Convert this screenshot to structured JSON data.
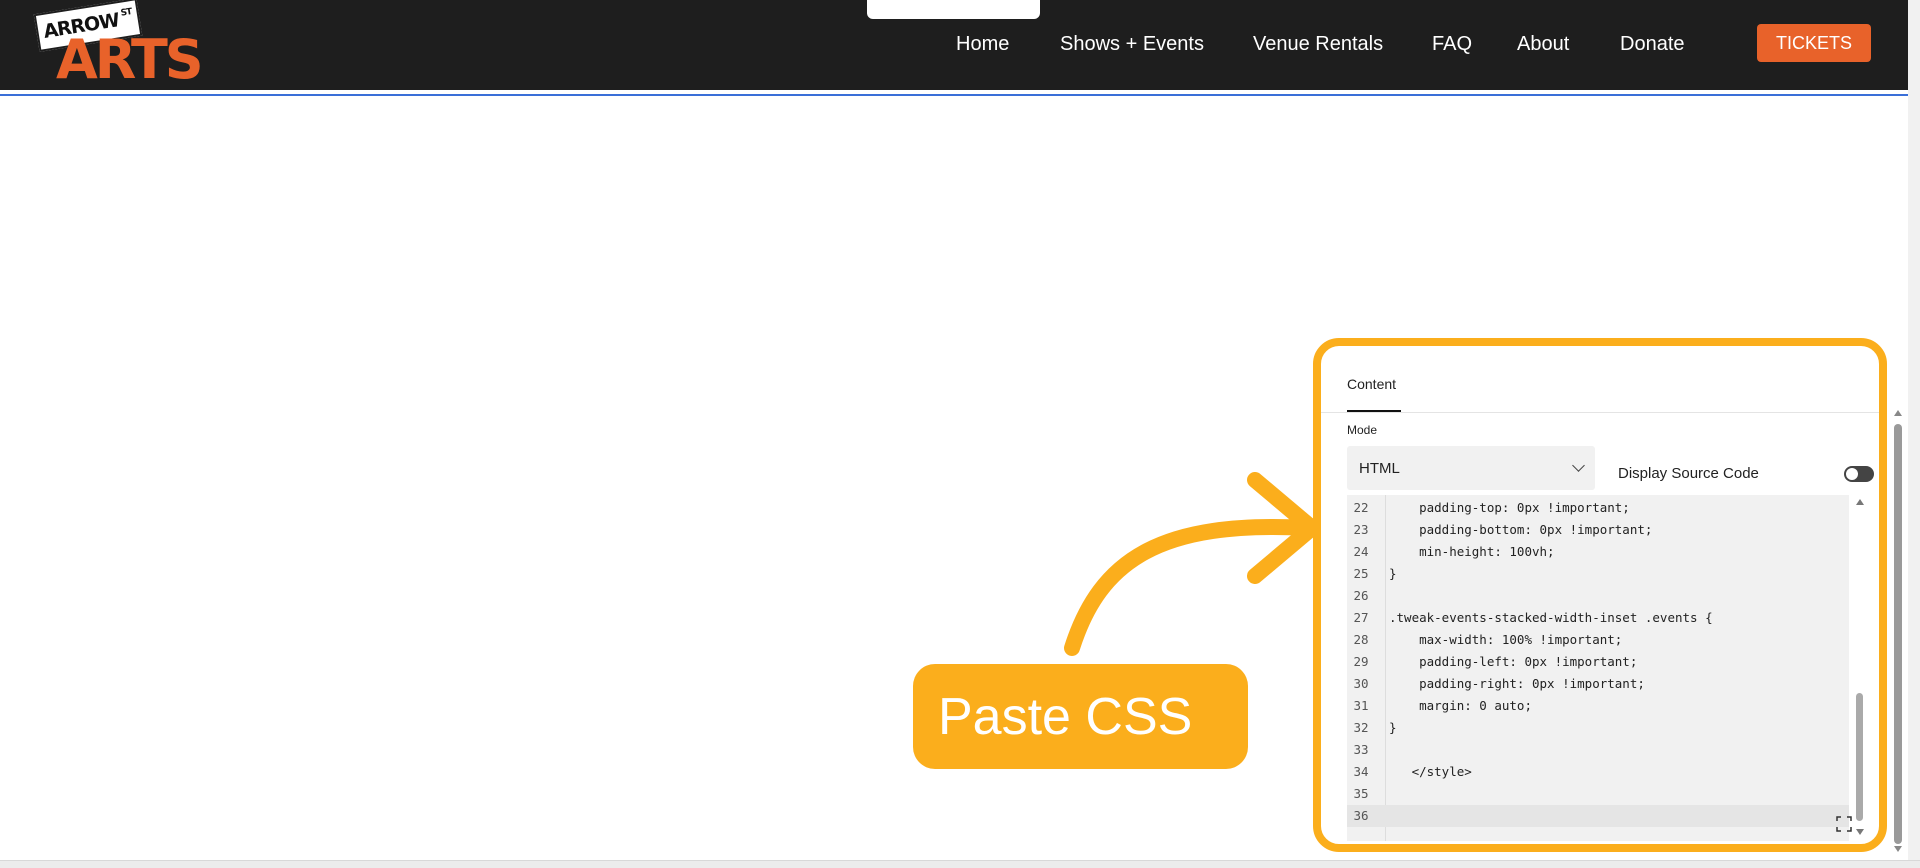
{
  "header": {
    "logo": {
      "top_text": "ARROW",
      "top_suffix": "ST",
      "main_text": "ARTS"
    },
    "nav": [
      {
        "label": "Home"
      },
      {
        "label": "Shows + Events"
      },
      {
        "label": "Venue Rentals"
      },
      {
        "label": "FAQ"
      },
      {
        "label": "About"
      },
      {
        "label": "Donate"
      }
    ],
    "tickets_label": "TICKETS"
  },
  "panel": {
    "tab_label": "Content",
    "mode_label": "Mode",
    "mode_value": "HTML",
    "display_source_label": "Display Source Code",
    "display_source_on": false,
    "code_lines": [
      {
        "n": "22",
        "text": "    padding-top: 0px !important;"
      },
      {
        "n": "23",
        "text": "    padding-bottom: 0px !important;"
      },
      {
        "n": "24",
        "text": "    min-height: 100vh;"
      },
      {
        "n": "25",
        "text": "}"
      },
      {
        "n": "26",
        "text": ""
      },
      {
        "n": "27",
        "text": ".tweak-events-stacked-width-inset .events {"
      },
      {
        "n": "28",
        "text": "    max-width: 100% !important;"
      },
      {
        "n": "29",
        "text": "    padding-left: 0px !important;"
      },
      {
        "n": "30",
        "text": "    padding-right: 0px !important;"
      },
      {
        "n": "31",
        "text": "    margin: 0 auto;"
      },
      {
        "n": "32",
        "text": "}"
      },
      {
        "n": "33",
        "text": ""
      },
      {
        "n": "34",
        "text": "   </style>"
      },
      {
        "n": "35",
        "text": ""
      },
      {
        "n": "36",
        "text": ""
      }
    ],
    "active_line": "36"
  },
  "callout": {
    "label": "Paste CSS"
  },
  "colors": {
    "accent": "#fbae1c",
    "brand": "#e8622a",
    "header_bg": "#1e1e1e"
  }
}
